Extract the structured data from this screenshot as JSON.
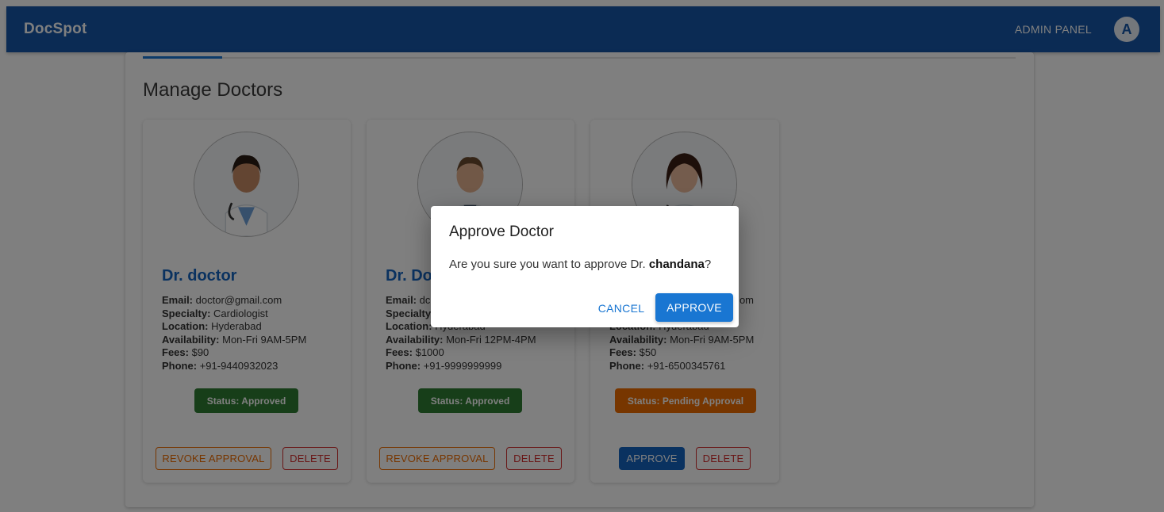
{
  "appbar": {
    "brand": "DocSpot",
    "admin_label": "ADMIN PANEL",
    "avatar_letter": "A",
    "color": "#1656a8"
  },
  "page": {
    "title": "Manage Doctors"
  },
  "doctors": [
    {
      "name": "Dr. doctor",
      "email_label": "Email:",
      "email": "doctor@gmail.com",
      "specialty_label": "Specialty:",
      "specialty": "Cardiologist",
      "location_label": "Location:",
      "location": "Hyderabad",
      "availability_label": "Availability:",
      "availability": "Mon-Fri 9AM-5PM",
      "fees_label": "Fees:",
      "fees": "$90",
      "phone_label": "Phone:",
      "phone": "+91-9440932023",
      "status": "Status: Approved",
      "actions": [
        "REVOKE APPROVAL",
        "DELETE"
      ]
    },
    {
      "name": "Dr. Do",
      "email_label": "Email:",
      "email": "dc",
      "specialty_label": "Specialty",
      "specialty": "",
      "location_label": "Location:",
      "location": "Hyderabad",
      "availability_label": "Availability:",
      "availability": "Mon-Fri 12PM-4PM",
      "fees_label": "Fees:",
      "fees": "$1000",
      "phone_label": "Phone:",
      "phone": "+91-9999999999",
      "status": "Status: Approved",
      "actions": [
        "REVOKE APPROVAL",
        "DELETE"
      ]
    },
    {
      "name": "",
      "email_label": "",
      "email": "om",
      "specialty_label": "",
      "specialty": "",
      "location_label": "Location:",
      "location": "Hyderabad",
      "availability_label": "Availability:",
      "availability": "Mon-Fri 9AM-5PM",
      "fees_label": "Fees:",
      "fees": "$50",
      "phone_label": "Phone:",
      "phone": "+91-6500345761",
      "status": "Status: Pending Approval",
      "actions": [
        "APPROVE",
        "DELETE"
      ]
    }
  ],
  "dialog": {
    "title": "Approve Doctor",
    "text_prefix": "Are you sure you want to approve Dr.",
    "doctor_name": "chandana",
    "text_suffix": "?",
    "cancel_label": "CANCEL",
    "approve_label": "APPROVE"
  },
  "colors": {
    "approved": "#2e7d32",
    "pending": "#ef6c00",
    "primary": "#1976d2",
    "danger": "#d32f2f"
  },
  "icons": {
    "doctor_photo": "doctor-portrait-icon"
  }
}
